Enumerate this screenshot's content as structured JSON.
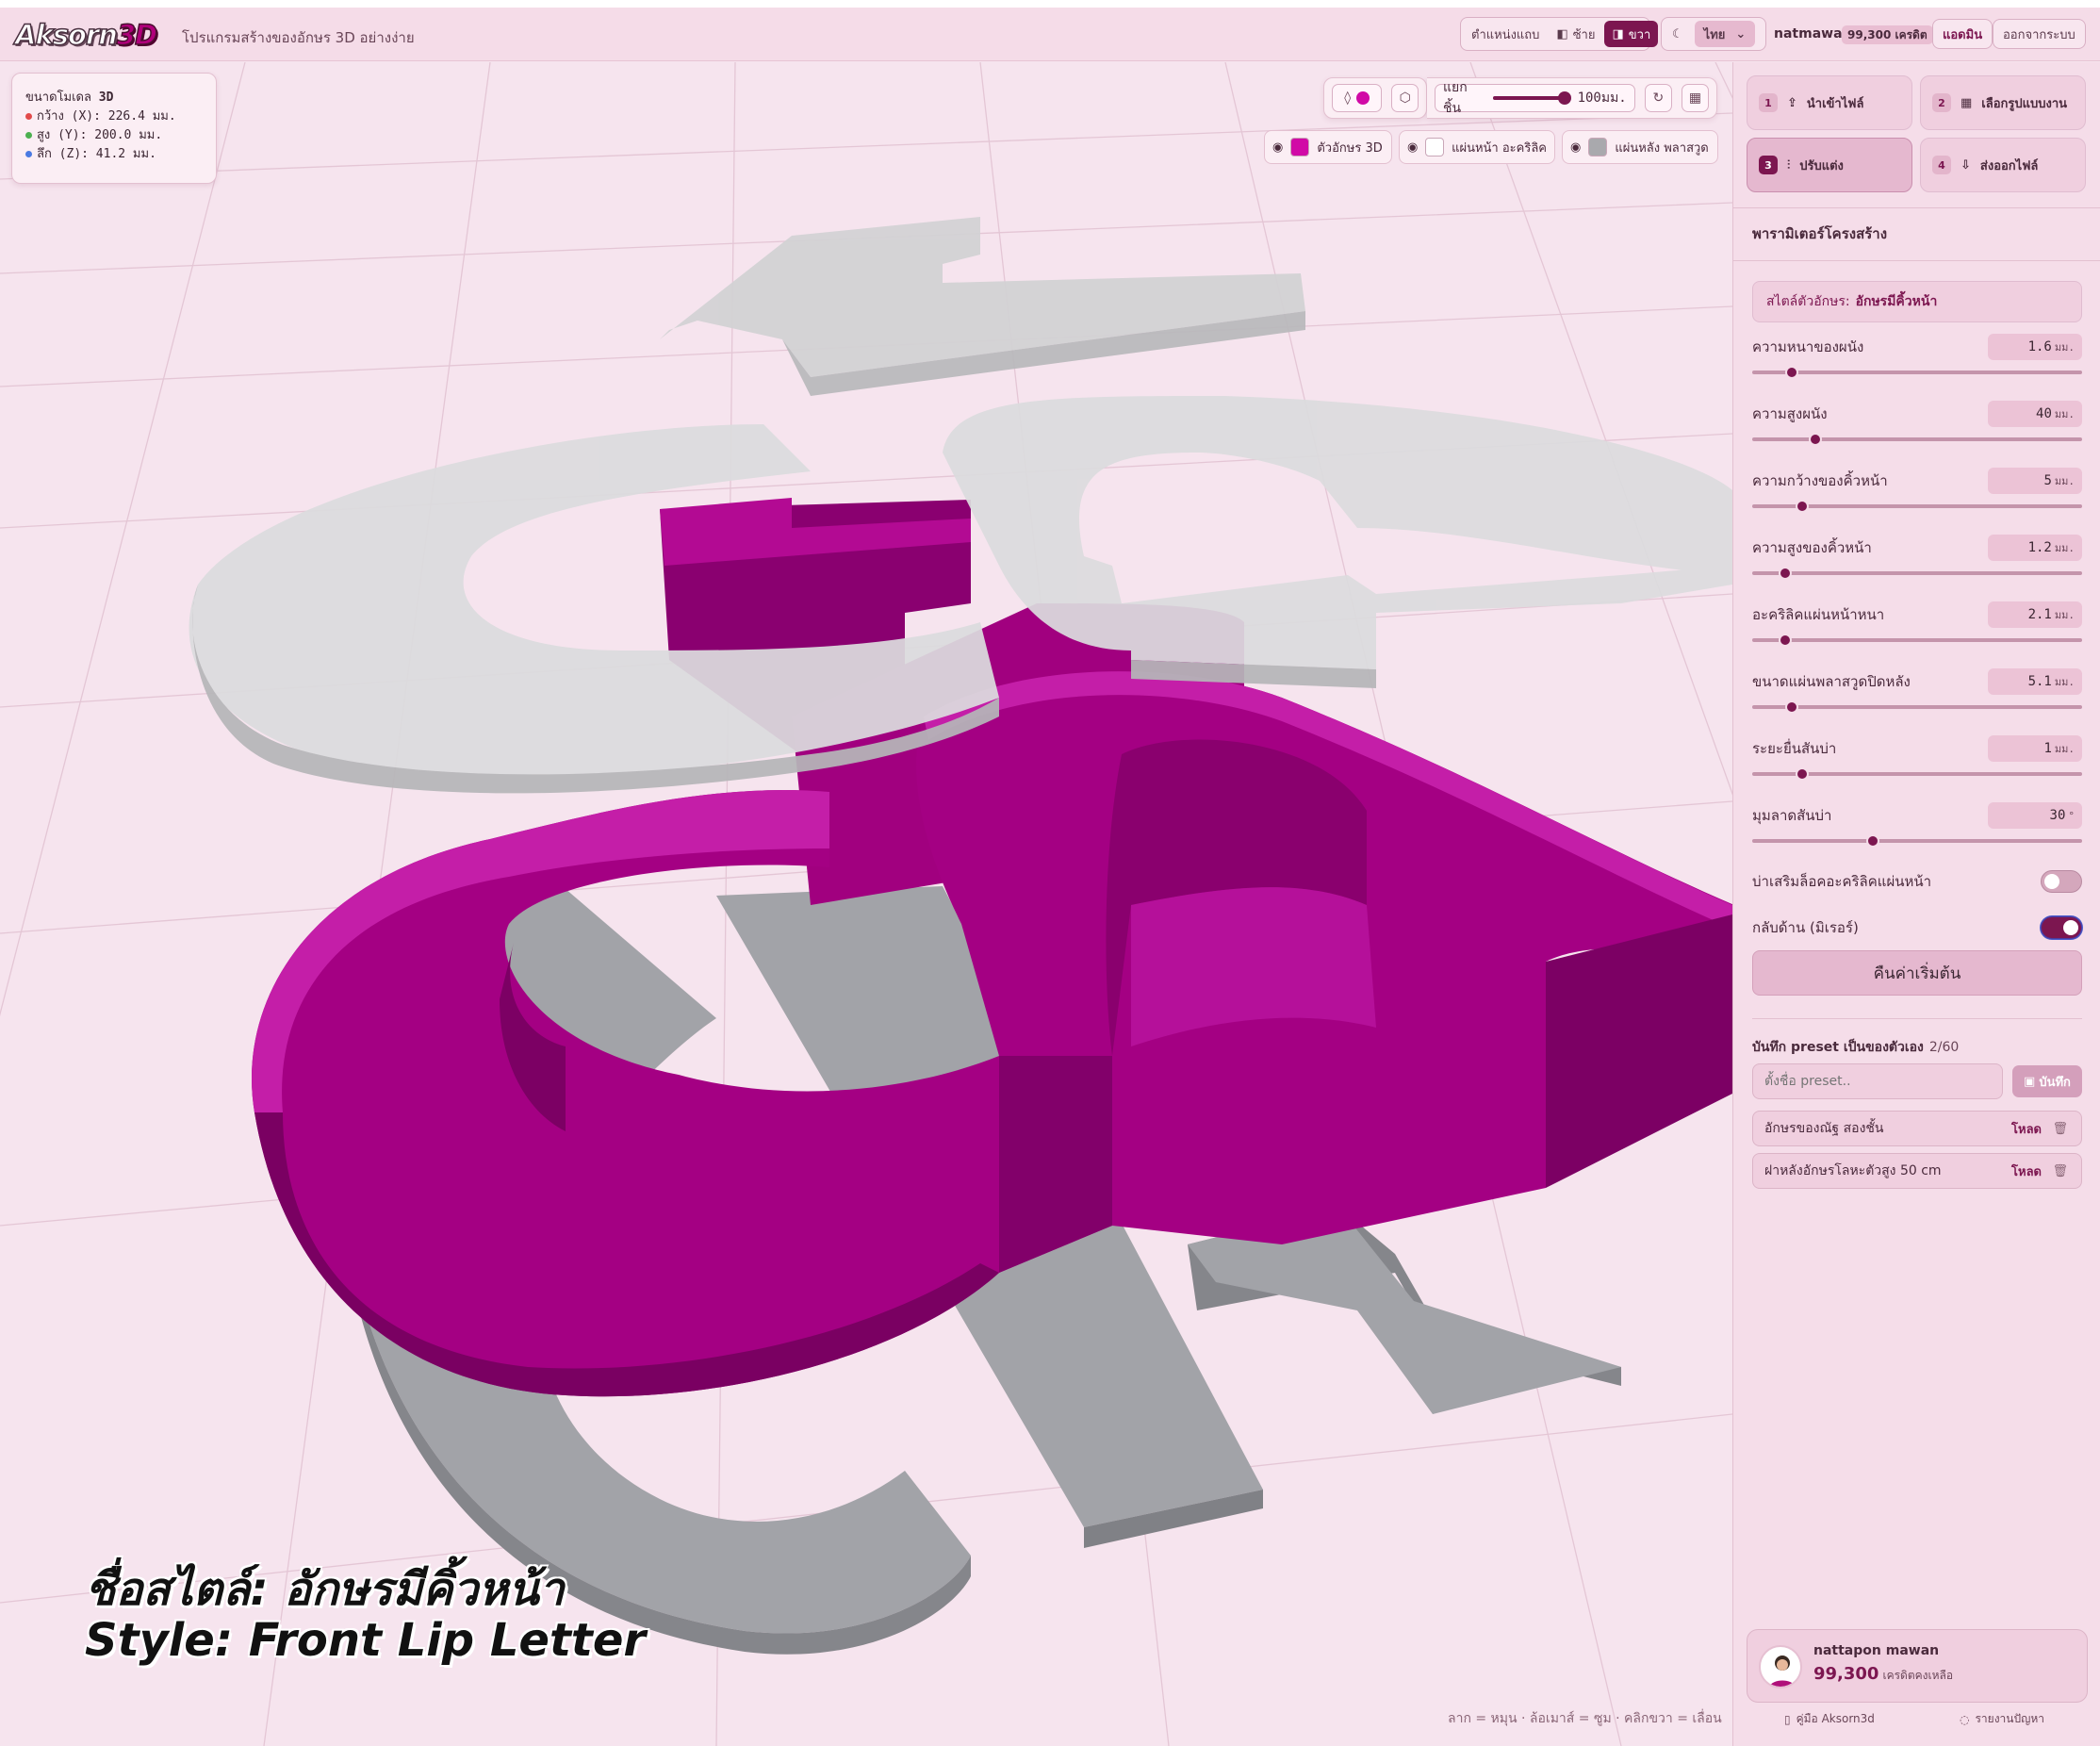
{
  "header": {
    "logo_a": "Aksorn",
    "logo_b": "3D",
    "tagline": "โปรแกรมสร้างของอักษร 3D อย่างง่าย",
    "position_label": "ตำแหน่งแถบ",
    "left_label": "ซ้าย",
    "right_label": "ขวา",
    "language": "ไทย",
    "username": "natmawan",
    "credits": "99,300 เครดิต",
    "admin_label": "แอดมิน",
    "logout_label": "ออกจากระบบ"
  },
  "dimensions": {
    "title_a": "ขนาดโมเดล ",
    "title_b": "3D",
    "width": "กว้าง (X): 226.4 มม.",
    "height": "สูง (Y): 200.0 มม.",
    "depth": "ลึก (Z): 41.2 มม."
  },
  "view_toolbar": {
    "explode_label": "แยกชิ้น",
    "explode_value": "100มม.",
    "explode_fraction": 0.95
  },
  "layers": [
    {
      "label": "ตัวอักษร 3D",
      "color": "#d10aa6"
    },
    {
      "label": "แผ่นหน้า อะคริลิค",
      "color": "#ffffff"
    },
    {
      "label": "แผ่นหลัง พลาสวูด",
      "color": "#a9a9ad"
    }
  ],
  "caption": {
    "line1": "ชื่อสไตล์: อักษรมีคิ้วหน้า",
    "line2": "Style: Front Lip Letter"
  },
  "hint": "ลาก = หมุน · ล้อเมาส์ = ซูม · คลิกขวา = เลื่อน",
  "steps": [
    {
      "n": "1",
      "label": "นำเข้าไฟล์"
    },
    {
      "n": "2",
      "label": "เลือกรูปแบบงาน"
    },
    {
      "n": "3",
      "label": "ปรับแต่ง"
    },
    {
      "n": "4",
      "label": "ส่งออกไฟล์"
    }
  ],
  "panel": {
    "title": "พารามิเตอร์โครงสร้าง",
    "style_prefix": "สไตล์ตัวอักษร:",
    "style_name": "อักษรมีคิ้วหน้า",
    "params": [
      {
        "label": "ความหนาของผนัง",
        "value": "1.6",
        "unit": "มม.",
        "pos": 0.12
      },
      {
        "label": "ความสูงผนัง",
        "value": "40",
        "unit": "มม.",
        "pos": 0.19
      },
      {
        "label": "ความกว้างของคิ้วหน้า",
        "value": "5",
        "unit": "มม.",
        "pos": 0.15
      },
      {
        "label": "ความสูงของคิ้วหน้า",
        "value": "1.2",
        "unit": "มม.",
        "pos": 0.1
      },
      {
        "label": "อะคริลิคแผ่นหน้าหนา",
        "value": "2.1",
        "unit": "มม.",
        "pos": 0.1
      },
      {
        "label": "ขนาดแผ่นพลาสวูดปิดหลัง",
        "value": "5.1",
        "unit": "มม.",
        "pos": 0.12
      },
      {
        "label": "ระยะยื่นสันบ่า",
        "value": "1",
        "unit": "มม.",
        "pos": 0.15
      },
      {
        "label": "มุมลาดสันบ่า",
        "value": "30",
        "unit": "°",
        "pos": 0.365
      }
    ],
    "toggle1": "บ่าเสริมล็อคอะคริลิคแผ่นหน้า",
    "toggle2": "กลับด้าน (มิเรอร์)",
    "reset": "คืนค่าเริ่มต้น",
    "preset_title": "บันทึก preset เป็นของตัวเอง",
    "preset_count": "2/60",
    "preset_placeholder": "ตั้งชื่อ preset..",
    "save_label": "บันทึก",
    "load_label": "โหลด",
    "presets": [
      "อักษรของณัฐ สองชั้น",
      "ฝาหลังอักษรโลหะตัวสูง 50 cm"
    ]
  },
  "user": {
    "name": "nattapon mawan",
    "credits": "99,300",
    "credits_label": "เครดิตคงเหลือ",
    "manual": "คู่มือ Aksorn3d",
    "report": "รายงานปัญหา"
  }
}
